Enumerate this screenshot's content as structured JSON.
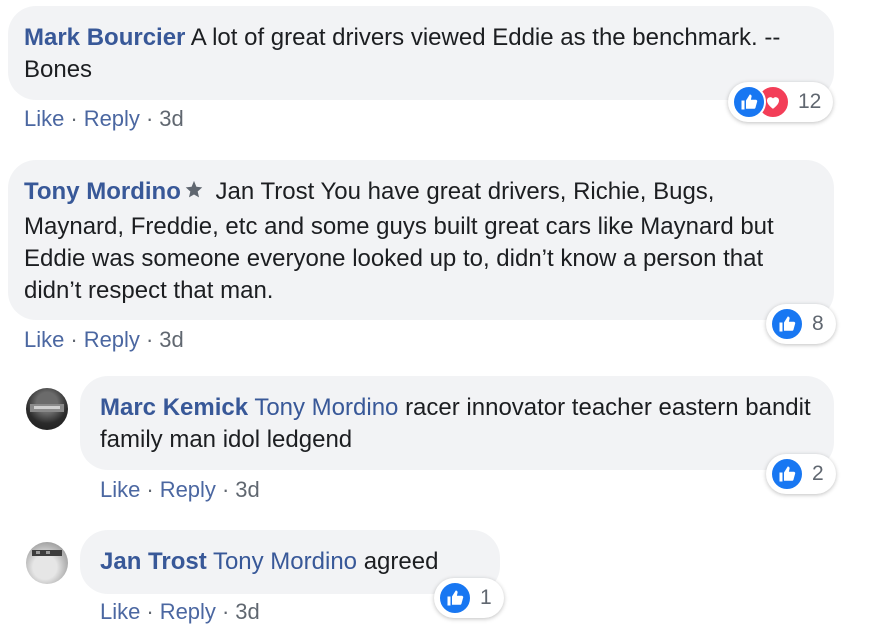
{
  "comments": [
    {
      "author": "Mark Bourcier",
      "mention": "",
      "text": "A lot of great drivers viewed Eddie as the benchmark. -- Bones",
      "actions": {
        "like": "Like",
        "reply": "Reply",
        "time": "3d"
      },
      "reactions": {
        "icons": [
          "like-icon",
          "heart-icon"
        ],
        "count": "12"
      }
    },
    {
      "author": "Tony Mordino",
      "badge": "top-fan-icon",
      "mention": "",
      "text": "Jan Trost You have great drivers, Richie, Bugs, Maynard, Freddie, etc and some guys built great cars like Maynard but Eddie was someone everyone looked up to, didn’t know a person that didn’t respect that man.",
      "actions": {
        "like": "Like",
        "reply": "Reply",
        "time": "3d"
      },
      "reactions": {
        "icons": [
          "like-icon"
        ],
        "count": "8"
      }
    },
    {
      "author": "Marc Kemick",
      "mention": "Tony Mordino",
      "text": "racer innovator teacher eastern bandit family man idol ledgend",
      "actions": {
        "like": "Like",
        "reply": "Reply",
        "time": "3d"
      },
      "reactions": {
        "icons": [
          "like-icon"
        ],
        "count": "2"
      }
    },
    {
      "author": "Jan Trost",
      "mention": "Tony Mordino",
      "text": "agreed",
      "actions": {
        "like": "Like",
        "reply": "Reply",
        "time": "3d"
      },
      "reactions": {
        "icons": [
          "like-icon"
        ],
        "count": "1"
      }
    }
  ],
  "separator": "·",
  "colors": {
    "link": "#385898",
    "bubble": "#f2f3f5",
    "like": "#1877f2",
    "heart": "#f33e58"
  }
}
